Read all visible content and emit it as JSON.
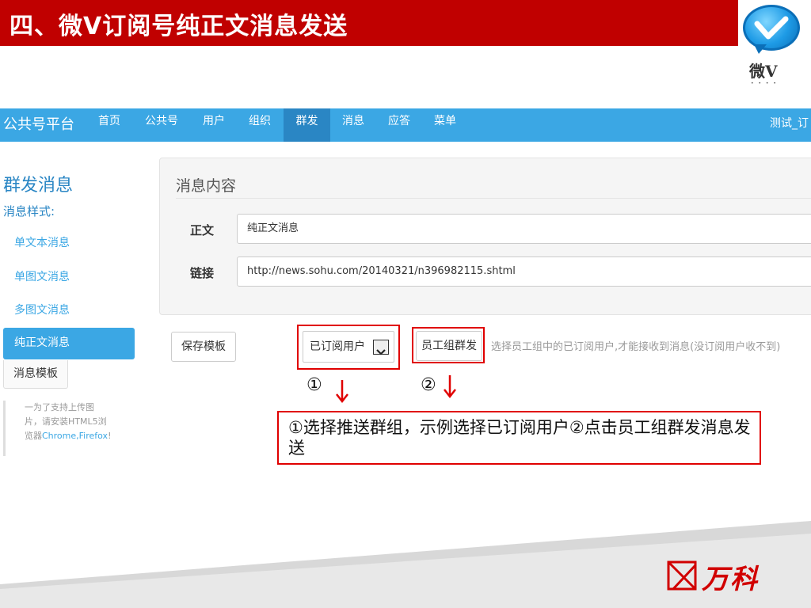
{
  "slide": {
    "title": "四、微V订阅号纯正文消息发送",
    "logo_text": "微V"
  },
  "navbar": {
    "brand": "公共号平台",
    "items": [
      {
        "label": "首页",
        "active": false
      },
      {
        "label": "公共号",
        "active": false
      },
      {
        "label": "用户",
        "active": false
      },
      {
        "label": "组织",
        "active": false
      },
      {
        "label": "群发",
        "active": true
      },
      {
        "label": "消息",
        "active": false
      },
      {
        "label": "应答",
        "active": false
      },
      {
        "label": "菜单",
        "active": false
      }
    ],
    "user": "测试_订"
  },
  "sidebar": {
    "title": "群发消息",
    "subtitle": "消息样式:",
    "items": [
      {
        "label": "单文本消息"
      },
      {
        "label": "单图文消息"
      },
      {
        "label": "多图文消息"
      },
      {
        "label": "纯正文消息",
        "active": true
      }
    ],
    "template_button": "消息模板",
    "note_line1": "一为了支持上传图",
    "note_line2": "片，请安装HTML5浏",
    "note_line3_prefix": "览器",
    "note_line3_browsers": "Chrome,Firefox",
    "note_line3_suffix": "!"
  },
  "panel": {
    "title": "消息内容",
    "body_label": "正文",
    "body_value": "纯正文消息",
    "link_label": "链接",
    "link_value": "http://news.sohu.com/20140321/n396982115.shtml"
  },
  "controls": {
    "save_button": "保存模板",
    "audience_select": "已订阅用户",
    "group_send_button": "员工组群发",
    "hint": "选择员工组中的已订阅用户,才能接收到消息(没订阅用户收不到)"
  },
  "annotation": {
    "marker1": "①",
    "marker2": "②",
    "callout": "①选择推送群组，示例选择已订阅用户②点击员工组群发消息发送"
  },
  "footer": {
    "brand": "万科"
  },
  "colors": {
    "title_bar": "#c00000",
    "navbar": "#3ba7e4",
    "navbar_active": "#2a86c4",
    "accent_blue": "#2a86c4",
    "annotation_red": "#e00000",
    "brand_red": "#d10000"
  },
  "icons": {
    "logo": "chat-bubble-check-icon",
    "dropdown": "chevron-down-icon",
    "arrow": "arrow-down-icon",
    "brand_mark": "vanke-logo-icon"
  }
}
